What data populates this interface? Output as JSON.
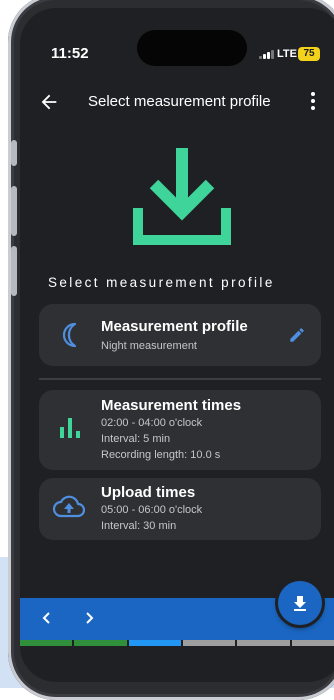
{
  "status_bar": {
    "time": "11:52",
    "network": "LTE",
    "battery": "75"
  },
  "app_bar": {
    "title": "Select measurement profile"
  },
  "section": {
    "title": "Select measurement profile"
  },
  "profile_card": {
    "title": "Measurement profile",
    "subtitle": "Night measurement"
  },
  "times_card": {
    "title": "Measurement times",
    "lines": [
      "02:00 - 04:00 o'clock",
      "Interval: 5 min",
      "Recording length: 10.0 s"
    ]
  },
  "upload_card": {
    "title": "Upload times",
    "lines": [
      "05:00 - 06:00 o'clock",
      "Interval: 30 min"
    ]
  },
  "icons": {
    "back": "arrow-left-icon",
    "more": "more-vertical-icon",
    "hero": "download-icon",
    "profile": "moon-icon",
    "edit": "pencil-icon",
    "times": "bar-chart-icon",
    "upload": "cloud-upload-icon",
    "fab": "download-icon",
    "prev": "chevron-left-icon",
    "next": "chevron-right-icon"
  },
  "colors": {
    "accent_green": "#3fd49a",
    "accent_blue": "#1a66c2",
    "card_bg": "#2f3034",
    "screen_bg": "#1f2023",
    "strip": [
      "#2f8f3a",
      "#2f8f3a",
      "#2196f3",
      "#9e9e9e",
      "#9e9e9e",
      "#9e9e9e"
    ]
  }
}
